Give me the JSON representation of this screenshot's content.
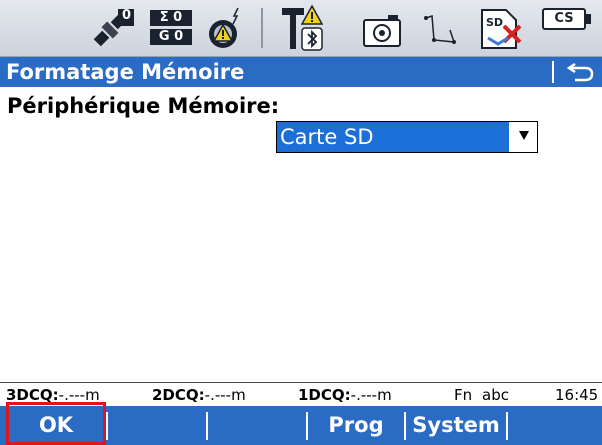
{
  "status_bar": {
    "satellite_count": "0",
    "sigma_value": "Σ 0",
    "g_value": "G 0",
    "cs_label": "CS",
    "sd_label": "SD"
  },
  "title_bar": {
    "title": "Formatage Mémoire"
  },
  "form": {
    "label": "Périphérique Mémoire:",
    "device_selected": "Carte SD"
  },
  "info_bar": {
    "q3_label": "3DCQ:",
    "q3_value": "-.---m",
    "q2_label": "2DCQ:",
    "q2_value": "-.---m",
    "q1_label": "1DCQ:",
    "q1_value": "-.---m",
    "fn_label": "Fn",
    "input_mode": "abc",
    "time": "16:45"
  },
  "softkeys": {
    "f1": "OK",
    "f4": "Prog",
    "f5": "System"
  },
  "colors": {
    "title_bar": "#2a6bc3",
    "selection": "#1c6fd6",
    "highlight_box": "#e0141c"
  }
}
